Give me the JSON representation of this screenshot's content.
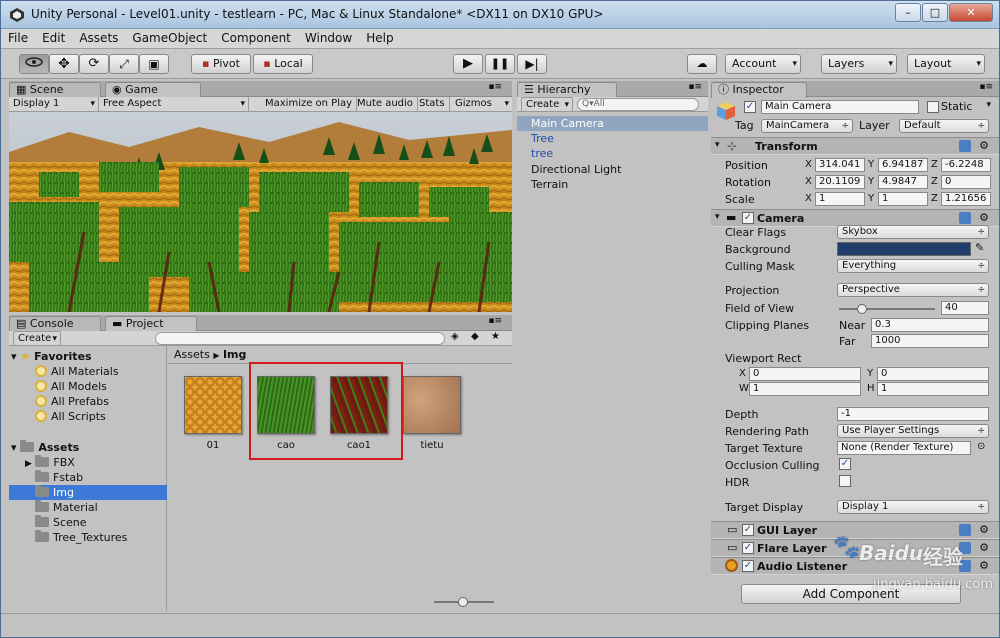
{
  "window": {
    "title": "Unity Personal - Level01.unity - testlearn - PC, Mac & Linux Standalone* <DX11 on DX10 GPU>"
  },
  "menu": [
    "File",
    "Edit",
    "Assets",
    "GameObject",
    "Component",
    "Window",
    "Help"
  ],
  "toolbar": {
    "pivot": "Pivot",
    "local": "Local",
    "account": "Account",
    "layers": "Layers",
    "layout": "Layout"
  },
  "scene_tabs": {
    "scene": "Scene",
    "game": "Game"
  },
  "game_bar": {
    "display": "Display 1",
    "aspect": "Free Aspect",
    "maximize": "Maximize on Play",
    "mute": "Mute audio",
    "stats": "Stats",
    "gizmos": "Gizmos"
  },
  "bottom_tabs": {
    "console": "Console",
    "project": "Project"
  },
  "project": {
    "create": "Create",
    "favorites_title": "Favorites",
    "favorites": [
      "All Materials",
      "All Models",
      "All Prefabs",
      "All Scripts"
    ],
    "assets_title": "Assets",
    "folders": [
      "FBX",
      "Fstab",
      "Img",
      "Material",
      "Scene",
      "Tree_Textures"
    ],
    "breadcrumb_root": "Assets",
    "breadcrumb_current": "Img",
    "items": [
      {
        "name": "01",
        "color": "#d98a1f"
      },
      {
        "name": "cao",
        "color": "#3f7f1e"
      },
      {
        "name": "cao1",
        "color": "#6e1a12"
      },
      {
        "name": "tietu",
        "color": "#b48761"
      }
    ],
    "highlight_color": "#d21a1a"
  },
  "hierarchy": {
    "title": "Hierarchy",
    "create": "Create",
    "search_placeholder": "Q▾All",
    "items": [
      "Main Camera",
      "Tree",
      "tree",
      "Directional Light",
      "Terrain"
    ]
  },
  "inspector": {
    "title": "Inspector",
    "object_name": "Main Camera",
    "static": "Static",
    "tag_label": "Tag",
    "tag": "MainCamera",
    "layer_label": "Layer",
    "layer": "Default",
    "transform": {
      "title": "Transform",
      "position_label": "Position",
      "position": [
        "314.041",
        "6.94187",
        "-6.2248"
      ],
      "rotation_label": "Rotation",
      "rotation": [
        "20.1109",
        "4.9847",
        "0"
      ],
      "scale_label": "Scale",
      "scale": [
        "1",
        "1",
        "1.21656"
      ]
    },
    "camera": {
      "title": "Camera",
      "clear_flags_label": "Clear Flags",
      "clear_flags": "Skybox",
      "background_label": "Background",
      "background_color": "#223d6a",
      "culling_mask_label": "Culling Mask",
      "culling_mask": "Everything",
      "projection_label": "Projection",
      "projection": "Perspective",
      "fov_label": "Field of View",
      "fov": "40",
      "clipping_label": "Clipping Planes",
      "near_label": "Near",
      "near": "0.3",
      "far_label": "Far",
      "far": "1000",
      "viewport_label": "Viewport Rect",
      "vx": "0",
      "vy": "0",
      "vw": "1",
      "vh": "1",
      "depth_label": "Depth",
      "depth": "-1",
      "rendering_path_label": "Rendering Path",
      "rendering_path": "Use Player Settings",
      "target_texture_label": "Target Texture",
      "target_texture": "None (Render Texture)",
      "occlusion_label": "Occlusion Culling",
      "hdr_label": "HDR",
      "target_display_label": "Target Display",
      "target_display": "Display 1"
    },
    "gui_layer": "GUI Layer",
    "flare_layer": "Flare Layer",
    "audio_listener": "Audio Listener",
    "add_component": "Add Component"
  },
  "watermark": {
    "brand": "Baidu",
    "text": "经验",
    "url": "jingyan.baidu.com"
  }
}
